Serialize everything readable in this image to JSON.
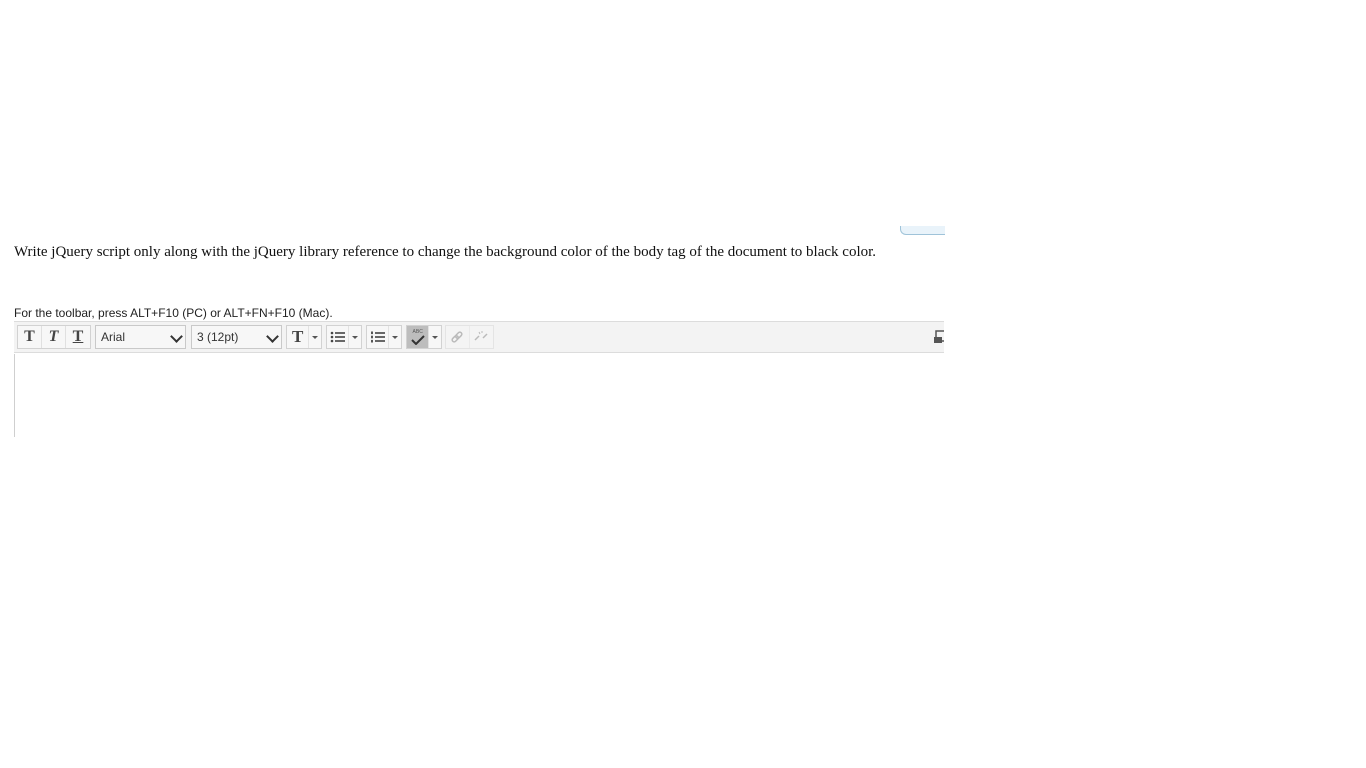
{
  "question": {
    "text": "Write jQuery script only along with the jQuery library reference to change the background color of the body tag of the document to black color."
  },
  "editor": {
    "toolbar_hint": "For the toolbar, press ALT+F10 (PC) or ALT+FN+F10 (Mac).",
    "font_family": {
      "selected": "Arial"
    },
    "font_size": {
      "selected": "3 (12pt)"
    },
    "buttons": {
      "bold_glyph": "T",
      "italic_glyph": "T",
      "underline_glyph": "T",
      "text_color_glyph": "T",
      "spellcheck_label": "ABC"
    },
    "content": ""
  },
  "icons": [
    "bold-icon",
    "italic-icon",
    "underline-icon",
    "text-color-icon",
    "bulleted-list-icon",
    "numbered-list-icon",
    "spellcheck-icon",
    "insert-link-icon",
    "remove-link-icon",
    "fullscreen-icon"
  ],
  "colors": {
    "toolbar_bg": "#f3f3f3",
    "border": "#d2d2d2",
    "active_button": "#bdbdbd",
    "text": "#111111"
  }
}
